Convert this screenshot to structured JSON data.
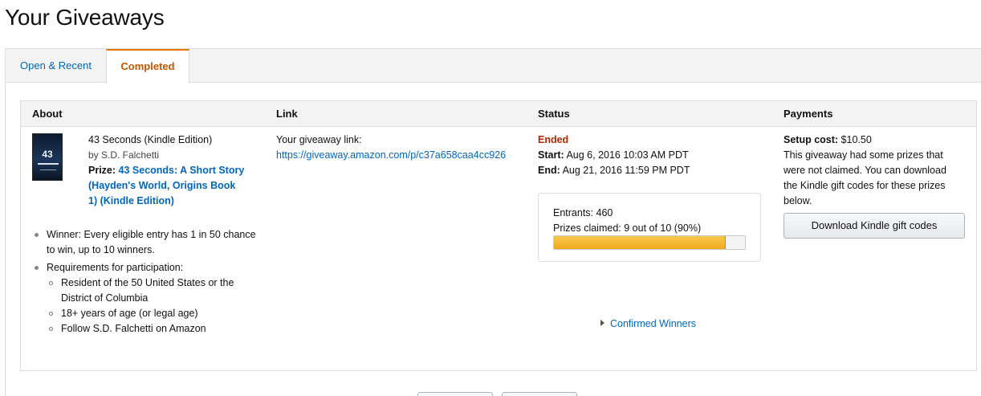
{
  "page": {
    "title": "Your Giveaways"
  },
  "tabs": [
    {
      "label": "Open & Recent",
      "active": false
    },
    {
      "label": "Completed",
      "active": true
    }
  ],
  "table": {
    "headers": {
      "about": "About",
      "link": "Link",
      "status": "Status",
      "payments": "Payments"
    }
  },
  "giveaway": {
    "about": {
      "item_title": "43 Seconds (Kindle Edition)",
      "author": "by S.D. Falchetti",
      "prize_label": "Prize:",
      "prize_line1": "43 Seconds: A Short Story",
      "prize_line2": "(Hayden's World, Origins Book",
      "prize_line3": "1) (Kindle Edition)",
      "cover_text": "43",
      "winner_line1": "Winner: Every eligible entry has 1 in 50 chance",
      "winner_line2": "to win, up to 10 winners.",
      "requirements_label": "Requirements for participation:",
      "requirements": [
        "Resident of the 50 United States or the",
        "District of Columbia",
        "18+ years of age (or legal age)",
        "Follow S.D. Falchetti on Amazon"
      ]
    },
    "link": {
      "label": "Your giveaway link:",
      "url": "https://giveaway.amazon.com/p/c37a658caa4cc926"
    },
    "status": {
      "state": "Ended",
      "start_label": "Start:",
      "start_value": "Aug 6, 2016 10:03 AM PDT",
      "end_label": "End:",
      "end_value": "Aug 21, 2016 11:59 PM PDT",
      "entrants_label": "Entrants:",
      "entrants_value": "460",
      "prizes_label": "Prizes claimed:",
      "prizes_value": "9 out of 10 (90%)",
      "prizes_fraction": 0.9,
      "winners_link": "Confirmed Winners"
    },
    "payments": {
      "setup_label": "Setup cost:",
      "setup_value": "$10.50",
      "note_line1": "This giveaway had some prizes that",
      "note_line2": "were not claimed. You can download",
      "note_line3": "the Kindle gift codes for these prizes",
      "note_line4": "below.",
      "button_label": "Download Kindle gift codes"
    }
  },
  "colors": {
    "link": "#0066c0",
    "active_tab": "#c45500",
    "ended": "#b12704",
    "progress": "#f0a91f"
  }
}
